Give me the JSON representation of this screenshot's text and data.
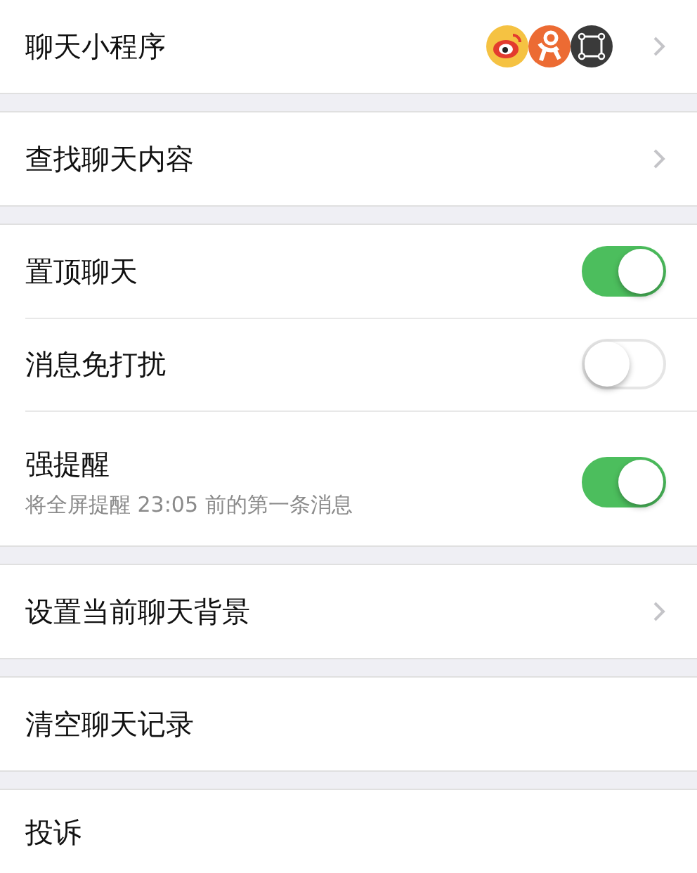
{
  "groups": [
    {
      "rows": [
        {
          "kind": "apps",
          "label": "聊天小程序"
        }
      ]
    },
    {
      "rows": [
        {
          "kind": "nav",
          "label": "查找聊天内容"
        }
      ]
    },
    {
      "rows": [
        {
          "kind": "toggle",
          "label": "置顶聊天",
          "on": true
        },
        {
          "kind": "toggle",
          "label": "消息免打扰",
          "on": false
        },
        {
          "kind": "toggle",
          "label": "强提醒",
          "on": true,
          "subtitle": "将全屏提醒 23:05 前的第一条消息"
        }
      ]
    },
    {
      "rows": [
        {
          "kind": "nav",
          "label": "设置当前聊天背景"
        }
      ]
    },
    {
      "rows": [
        {
          "kind": "plain",
          "label": "清空聊天记录"
        }
      ]
    },
    {
      "rows": [
        {
          "kind": "plain",
          "label": "投诉"
        }
      ]
    }
  ]
}
